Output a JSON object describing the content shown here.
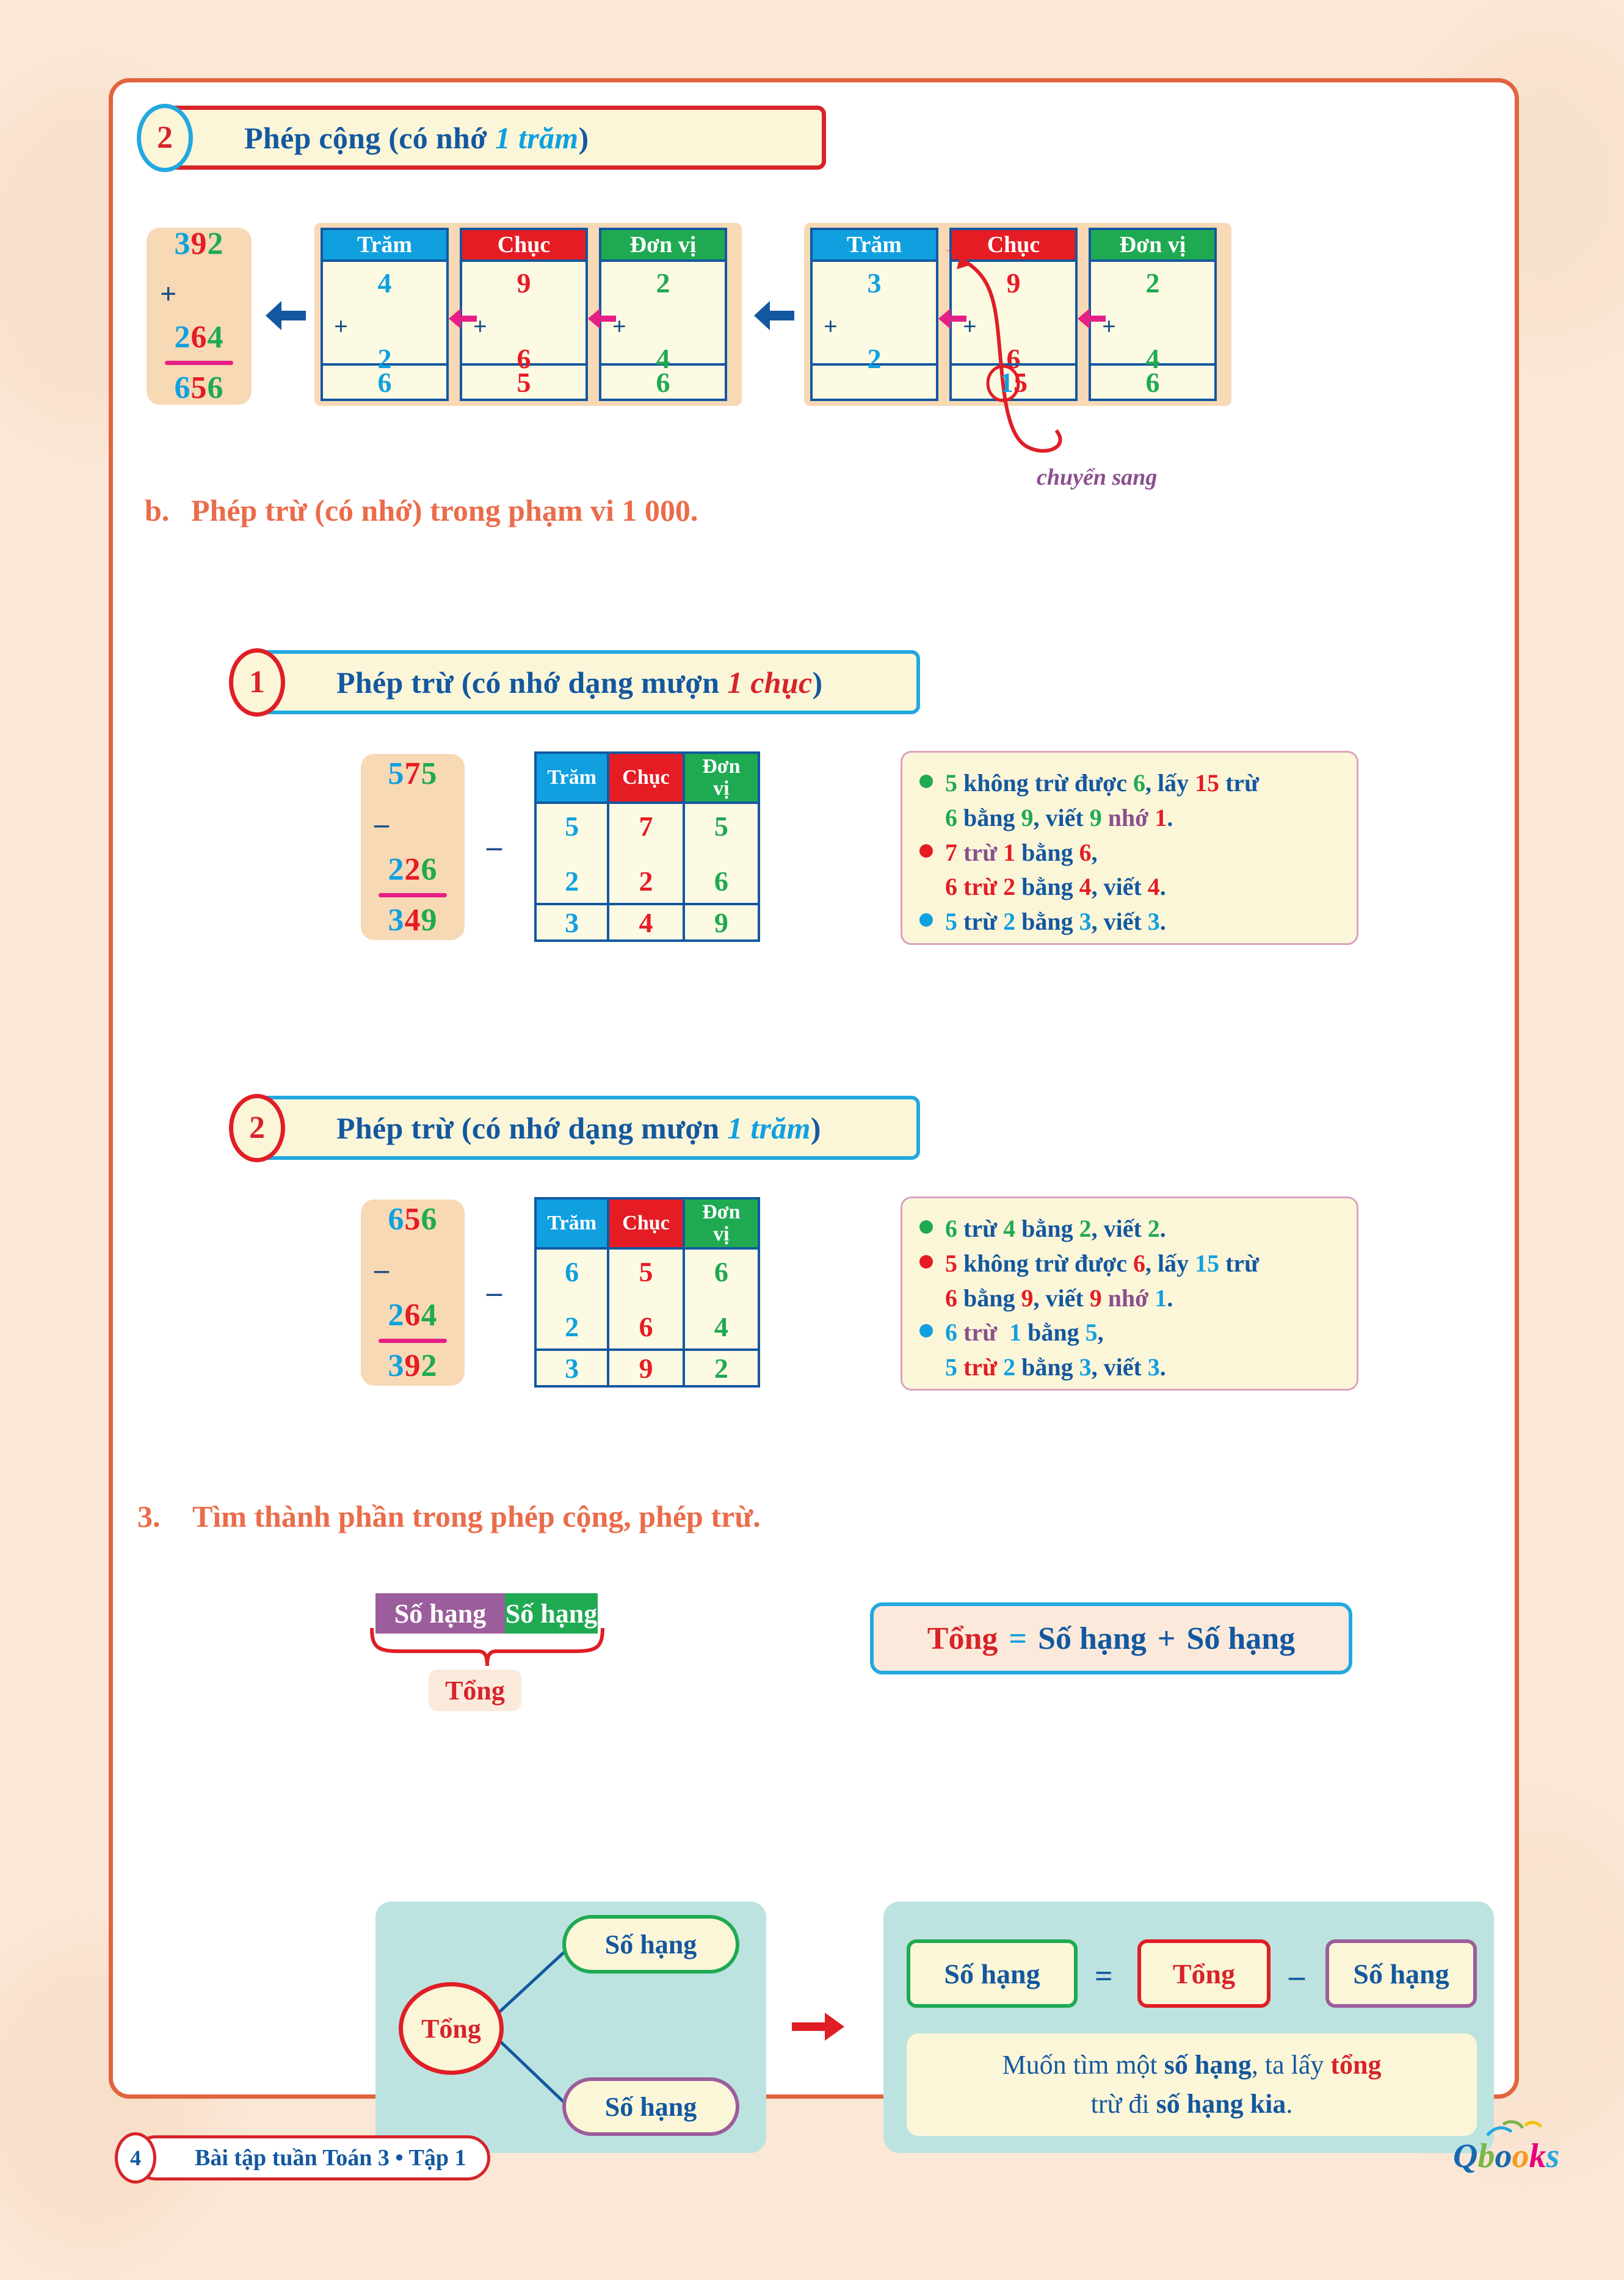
{
  "page": {
    "background_color": "#fbe7d6",
    "border_color": "#e0653f",
    "page_number": "4",
    "footer_text": "Bài tập tuần Toán 3 • Tập 1",
    "logo_text": "Qbooks"
  },
  "colors": {
    "hundreds": "#10a0e0",
    "tens": "#e51c24",
    "units": "#1faa52",
    "navy": "#1358a0",
    "purple": "#8a4f8e",
    "orange_heading": "#ea6c4a",
    "red": "#d8232a",
    "teal_panel": "#bde3e0",
    "peach_card": "#f7d9b5",
    "cream_box": "#fcf6d8"
  },
  "section_add": {
    "badge": "2",
    "title_plain": "Phép cộng (có nhớ ",
    "title_italic": "1 trăm",
    "title_close": ")",
    "vcard": {
      "top": "392",
      "op": "+",
      "bottom": "264",
      "result": "656"
    },
    "table_left": {
      "headers": [
        "Trăm",
        "Chục",
        "Đơn vị"
      ],
      "row1": [
        "4",
        "9",
        "2"
      ],
      "op": [
        "+",
        "+",
        "+"
      ],
      "row2": [
        "2",
        "6",
        "4"
      ],
      "sum": [
        "6",
        "5",
        "6"
      ]
    },
    "table_right": {
      "headers": [
        "Trăm",
        "Chục",
        "Đơn vị"
      ],
      "row1": [
        "3",
        "9",
        "2"
      ],
      "op": [
        "+",
        "+",
        "+"
      ],
      "row2": [
        "2",
        "6",
        "4"
      ],
      "sum": [
        "",
        "15",
        "6"
      ],
      "carry_digit": "1"
    },
    "carry_caption": "chuyển sang"
  },
  "section_b": {
    "label": "b.",
    "title": "Phép trừ (có nhớ) trong phạm vi 1 000."
  },
  "sub1": {
    "badge": "1",
    "title_plain": "Phép trừ (có nhớ dạng mượn ",
    "title_italic": "1 chục",
    "title_close": ")",
    "vcard": {
      "top": "575",
      "op": "–",
      "bottom": "226",
      "result": "349"
    },
    "minus_sign": "–",
    "table": {
      "headers": [
        "Trăm",
        "Chục",
        "Đơn",
        "vị"
      ],
      "row1": [
        "5",
        "7",
        "5"
      ],
      "row2": [
        "2",
        "2",
        "6"
      ],
      "result": [
        "3",
        "4",
        "9"
      ]
    },
    "explain": [
      {
        "bullet": "green",
        "line1": "5 không trừ được 6, lấy 15 trừ",
        "line2": "6 bằng 9, viết 9 nhớ 1."
      },
      {
        "bullet": "red",
        "line1": "7 trừ 1 bằng 6,",
        "line2": "6 trừ 2 bằng 4, viết 4."
      },
      {
        "bullet": "blue",
        "line1": "5 trừ 2 bằng 3, viết 3.",
        "line2": ""
      }
    ]
  },
  "sub2": {
    "badge": "2",
    "title_plain": "Phép trừ (có nhớ dạng mượn ",
    "title_italic": "1 trăm",
    "title_close": ")",
    "vcard": {
      "top": "656",
      "op": "–",
      "bottom": "264",
      "result": "392"
    },
    "minus_sign": "–",
    "table": {
      "headers": [
        "Trăm",
        "Chục",
        "Đơn",
        "vị"
      ],
      "row1": [
        "6",
        "5",
        "6"
      ],
      "row2": [
        "2",
        "6",
        "4"
      ],
      "result": [
        "3",
        "9",
        "2"
      ]
    },
    "explain": [
      {
        "bullet": "green",
        "line1": "6 trừ 4 bằng 2, viết 2.",
        "line2": ""
      },
      {
        "bullet": "red",
        "line1": "5 không trừ được 6, lấy 15 trừ",
        "line2": "6 bằng 9, viết 9 nhớ 1."
      },
      {
        "bullet": "blue",
        "line1": "6 trừ  1 bằng 5,",
        "line2": "5 trừ 2 bằng 3, viết 3."
      }
    ]
  },
  "section3": {
    "number": "3.",
    "title": "Tìm thành phần trong phép cộng, phép trừ.",
    "bar_left": "Số hạng",
    "bar_right": "Số hạng",
    "brace_label": "Tổng",
    "formula": {
      "tong": "Tổng",
      "eq": "=",
      "sohang1": "Số hạng",
      "plus": "+",
      "sohang2": "Số hạng"
    },
    "tree": {
      "root": "Tổng",
      "branch_top": "Số hạng",
      "branch_bottom": "Số hạng"
    },
    "equation": {
      "sohang": "Số hạng",
      "eq": "=",
      "tong": "Tổng",
      "minus": "–",
      "sohang2": "Số hạng"
    },
    "rule_line1_a": "Muốn tìm một ",
    "rule_line1_b": "số hạng",
    "rule_line1_c": ", ta lấy ",
    "rule_line1_d": "tổng",
    "rule_line2_a": "trừ đi ",
    "rule_line2_b": "số hạng kia",
    "rule_line2_c": "."
  }
}
